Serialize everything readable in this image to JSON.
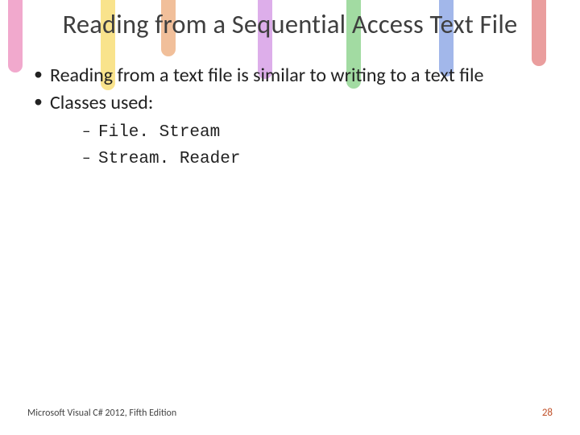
{
  "title": "Reading from a Sequential Access Text File",
  "bullets": {
    "b1": "Reading from a text file is similar to writing to a text file",
    "b2": "Classes used:"
  },
  "sub": {
    "s1": "File. Stream",
    "s2": "Stream. Reader"
  },
  "footer": {
    "left": "Microsoft Visual C# 2012, Fifth Edition",
    "right": "28"
  }
}
